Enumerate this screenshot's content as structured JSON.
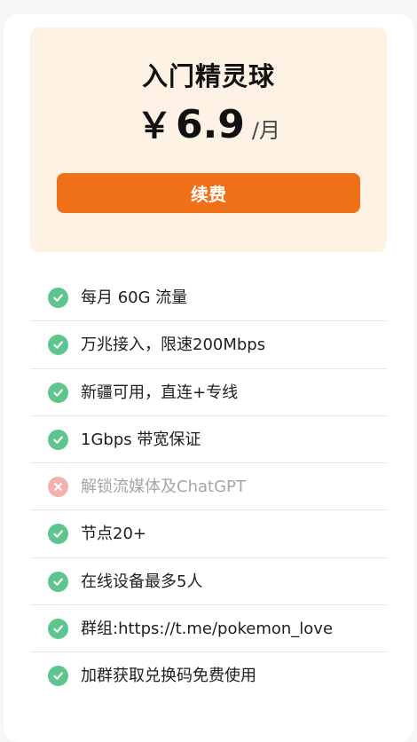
{
  "plan": {
    "name": "入门精灵球",
    "currency": "￥",
    "price": "6.9",
    "period": "/月",
    "renew_label": "续费"
  },
  "features": [
    {
      "text": "每月 60G 流量",
      "included": true
    },
    {
      "text": "万兆接入，限速200Mbps",
      "included": true
    },
    {
      "text": "新疆可用，直连+专线",
      "included": true
    },
    {
      "text": "1Gbps 带宽保证",
      "included": true
    },
    {
      "text": "解锁流媒体及ChatGPT",
      "included": false
    },
    {
      "text": "节点20+",
      "included": true
    },
    {
      "text": "在线设备最多5人",
      "included": true
    },
    {
      "text": "群组:https://t.me/pokemon_love",
      "included": true
    },
    {
      "text": "加群获取兑换码免费使用",
      "included": true
    }
  ],
  "colors": {
    "accent": "#f07018",
    "hero_background": "#fef2e4",
    "check": "#5ec58e",
    "cross": "#f2b1ad",
    "disabled_text": "#a6a6a6"
  },
  "icons": {
    "included": "check-icon",
    "excluded": "cross-icon"
  }
}
